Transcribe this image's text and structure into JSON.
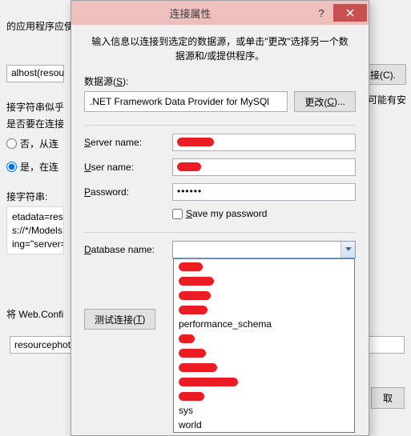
{
  "bg": {
    "line1": "的应用程序应使",
    "conn_text": "alhost(resour",
    "new_conn_btn": "建连接(C).",
    "line3a": "接字符串似乎",
    "line3b": "是否要在连接",
    "radio_no": "否，从连",
    "radio_yes": "是，在连",
    "conn_str_label": "接字符串:",
    "meta1": "etadata=res:",
    "meta2": "s://*/Models.",
    "meta3": "ing=\"server=",
    "webconfig_label": "将 Web.Confi",
    "entity_value": "resourcephotoEntities",
    "possible": "区可能有安",
    "cancel_btn": "取"
  },
  "dialog": {
    "title": "连接属性",
    "help": "?",
    "close": "✕",
    "intro": "输入信息以连接到选定的数据源，或单击\"更改\"选择另一个数据源和/或提供程序。",
    "ds_label_pre": "数据源(",
    "ds_label_u": "S",
    "ds_label_post": "):",
    "ds_value": ".NET Framework Data Provider for MySQl",
    "change_btn_pre": "更改(",
    "change_btn_u": "C",
    "change_btn_post": ")...",
    "server_label_u": "S",
    "server_label_rest": "erver name:",
    "user_label_u": "U",
    "user_label_rest": "ser name:",
    "pass_label_u": "P",
    "pass_label_rest": "assword:",
    "pass_value": "••••••",
    "save_u": "S",
    "save_rest": "ave my password",
    "db_label_u": "D",
    "db_label_rest": "atabase name:",
    "test_btn_pre": "测试连接(",
    "test_btn_u": "T",
    "test_btn_post": ")",
    "options": {
      "perf": "performance_schema",
      "sys": "sys",
      "world": "world"
    }
  }
}
